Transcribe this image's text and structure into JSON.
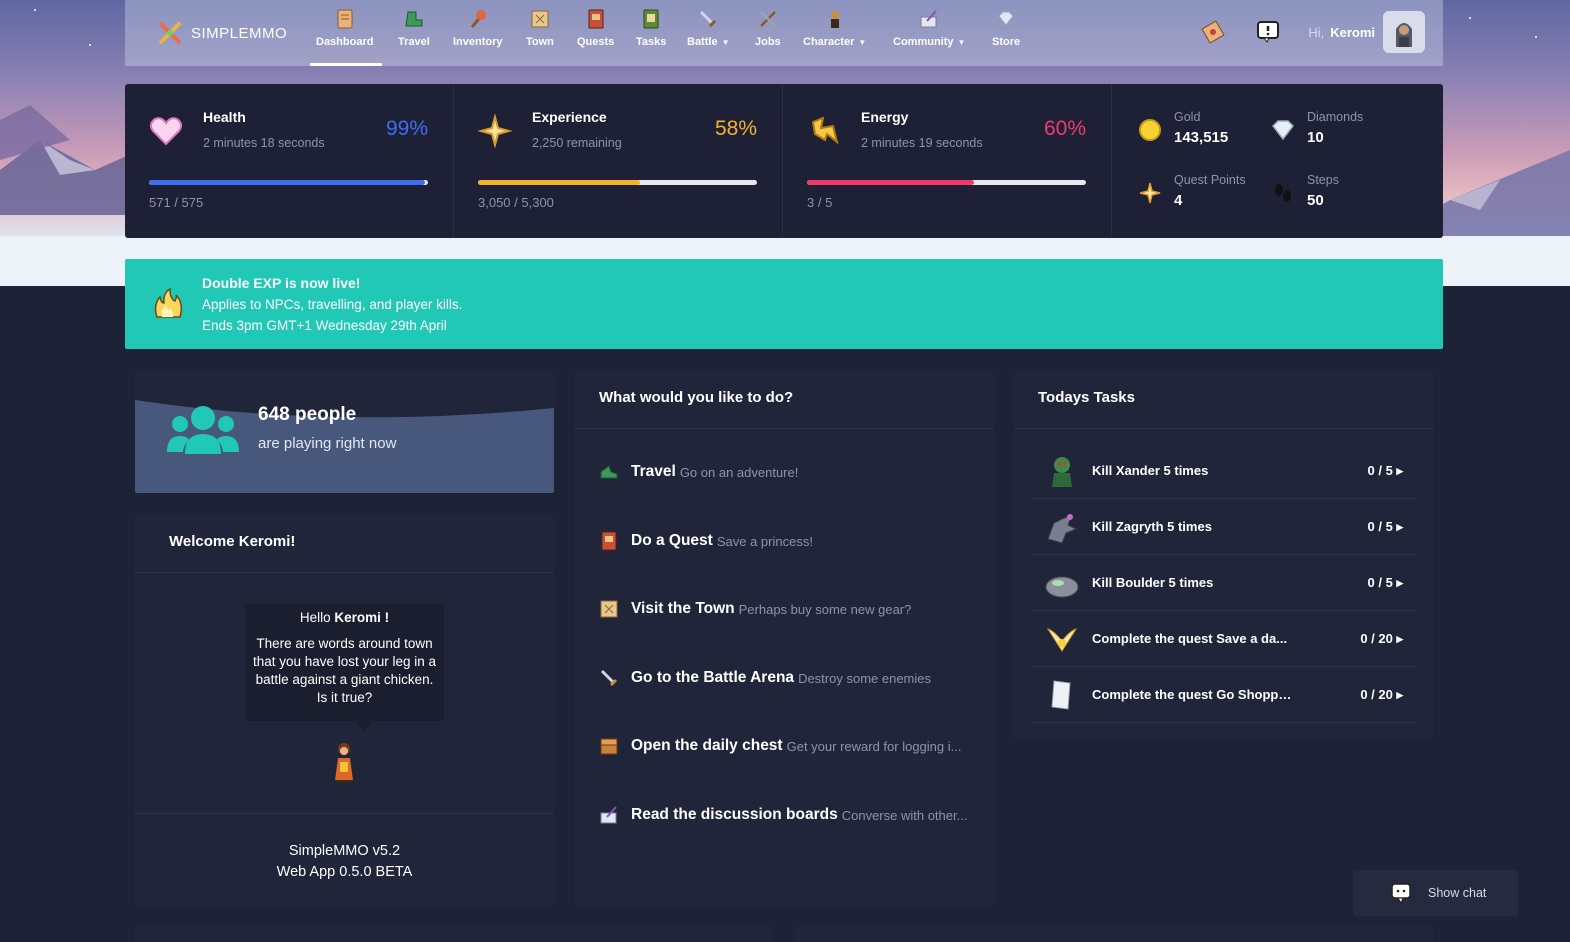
{
  "brand": {
    "name": "SIMPLEMMO"
  },
  "nav": {
    "items": [
      {
        "label": "Dashboard",
        "icon": "scroll-map-icon"
      },
      {
        "label": "Travel",
        "icon": "boot-icon"
      },
      {
        "label": "Inventory",
        "icon": "axe-icon"
      },
      {
        "label": "Town",
        "icon": "town-map-icon"
      },
      {
        "label": "Quests",
        "icon": "quest-book-icon"
      },
      {
        "label": "Tasks",
        "icon": "task-book-icon"
      },
      {
        "label": "Battle",
        "icon": "sword-icon",
        "dropdown": true
      },
      {
        "label": "Jobs",
        "icon": "tools-icon"
      },
      {
        "label": "Character",
        "icon": "character-icon",
        "dropdown": true
      },
      {
        "label": "Community",
        "icon": "scroll-quill-icon",
        "dropdown": true
      },
      {
        "label": "Store",
        "icon": "diamond-icon"
      }
    ],
    "active": "Dashboard",
    "greeting": "Hi,",
    "username": "Keromi"
  },
  "stats": {
    "health": {
      "title": "Health",
      "sub": "2 minutes 18 seconds",
      "pct": "99%",
      "value": "571 / 575",
      "fraction": 0.99,
      "color": "#3d6ef0"
    },
    "experience": {
      "title": "Experience",
      "sub": "2,250 remaining",
      "pct": "58%",
      "value": "3,050 / 5,300",
      "fraction": 0.58,
      "color": "#f4b22c"
    },
    "energy": {
      "title": "Energy",
      "sub": "2 minutes 19 seconds",
      "pct": "60%",
      "value": "3 / 5",
      "fraction": 0.6,
      "color": "#f03a6e"
    }
  },
  "currency": {
    "gold": {
      "label": "Gold",
      "value": "143,515"
    },
    "diamonds": {
      "label": "Diamonds",
      "value": "10"
    },
    "quest_points": {
      "label": "Quest Points",
      "value": "4"
    },
    "steps": {
      "label": "Steps",
      "value": "50"
    }
  },
  "banner": {
    "title": "Double EXP is now live!",
    "line1": "Applies to NPCs, travelling, and player kills.",
    "line2": "Ends 3pm GMT+1 Wednesday 29th April"
  },
  "online": {
    "count": "648 people",
    "text": "are playing right now"
  },
  "welcome": {
    "title": "Welcome Keromi!",
    "hello": "Hello",
    "hello_name": "Keromi !",
    "message": "There are words around town that you have lost your leg in a battle against a giant chicken. Is it true?",
    "version_line1": "SimpleMMO v5.2",
    "version_line2": "Web App 0.5.0 BETA"
  },
  "actions": {
    "title": "What would you like to do?",
    "items": [
      {
        "label": "Travel",
        "desc": "Go on an adventure!",
        "icon": "boot-icon"
      },
      {
        "label": "Do a Quest",
        "desc": "Save a princess!",
        "icon": "quest-book-icon"
      },
      {
        "label": "Visit the Town",
        "desc": "Perhaps buy some new gear?",
        "icon": "town-map-icon"
      },
      {
        "label": "Go to the Battle Arena",
        "desc": "Destroy some enemies",
        "icon": "sword-icon"
      },
      {
        "label": "Open the daily chest",
        "desc": "Get your reward for logging i...",
        "icon": "chest-icon"
      },
      {
        "label": "Read the discussion boards",
        "desc": "Converse with other...",
        "icon": "scroll-quill-icon"
      }
    ]
  },
  "tasks": {
    "title": "Todays Tasks",
    "items": [
      {
        "name": "Kill Xander 5 times",
        "progress": "0 / 5",
        "icon": "goblin-icon"
      },
      {
        "name": "Kill Zagryth 5 times",
        "progress": "0 / 5",
        "icon": "dragon-icon"
      },
      {
        "name": "Kill Boulder 5 times",
        "progress": "0 / 5",
        "icon": "boulder-icon"
      },
      {
        "name": "Complete the quest Save a da...",
        "progress": "0 / 20",
        "icon": "wings-icon"
      },
      {
        "name": "Complete the quest Go Shoppi...",
        "progress": "0 / 20",
        "icon": "scroll-icon"
      }
    ]
  },
  "chat": {
    "label": "Show chat"
  }
}
